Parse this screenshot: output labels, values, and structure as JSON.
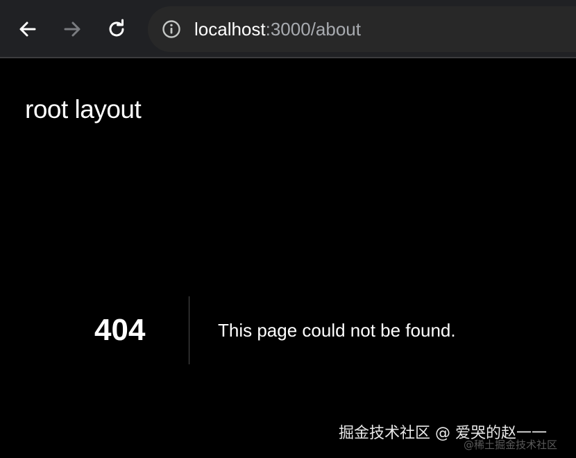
{
  "browser": {
    "url": {
      "host": "localhost",
      "rest": ":3000/about"
    },
    "icons": {
      "back": "arrow-left-icon",
      "forward": "arrow-right-icon",
      "reload": "reload-icon",
      "site_info": "info-circle-icon"
    },
    "colors": {
      "toolbar": "#202124",
      "omnibox": "#282828",
      "forward_disabled": "#7a7c80"
    }
  },
  "page": {
    "layout_title": "root layout",
    "error": {
      "code": "404",
      "message": "This page could not be found."
    },
    "background": "#000000"
  },
  "watermark": {
    "text": "掘金技术社区 @ 爱哭的赵一一",
    "faint_text": "@稀土掘金技术社区"
  }
}
